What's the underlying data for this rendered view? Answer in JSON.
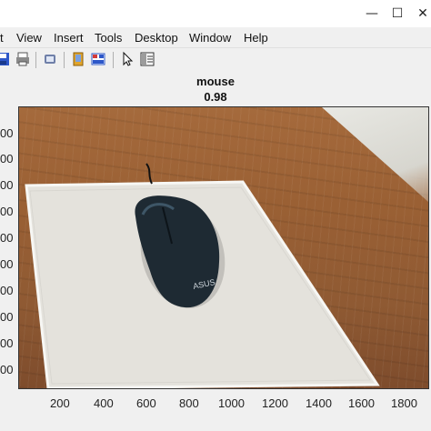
{
  "window": {
    "controls": {
      "minimize": "—",
      "maximize": "☐",
      "close": "✕"
    }
  },
  "menu": {
    "items": [
      "t",
      "View",
      "Insert",
      "Tools",
      "Desktop",
      "Window",
      "Help"
    ]
  },
  "toolbar": {
    "icons": [
      "save-icon",
      "print-icon",
      "link-icon",
      "data-cursor-icon",
      "colorbar-icon",
      "pointer-icon",
      "property-editor-icon"
    ]
  },
  "plot": {
    "title_line1": "mouse",
    "title_line2": "0.98",
    "x_ticks": [
      "200",
      "400",
      "600",
      "800",
      "1000",
      "1200",
      "1400",
      "1600",
      "1800"
    ],
    "y_ticks": [
      "00",
      "00",
      "00",
      "00",
      "00",
      "00",
      "00",
      "00",
      "00",
      "00"
    ],
    "image_label": "ASUS"
  },
  "colors": {
    "window_bg": "#f0f0f0",
    "wood": "#9a6034",
    "pad": "#e4e2dc",
    "mouse": "#1e2a33"
  }
}
